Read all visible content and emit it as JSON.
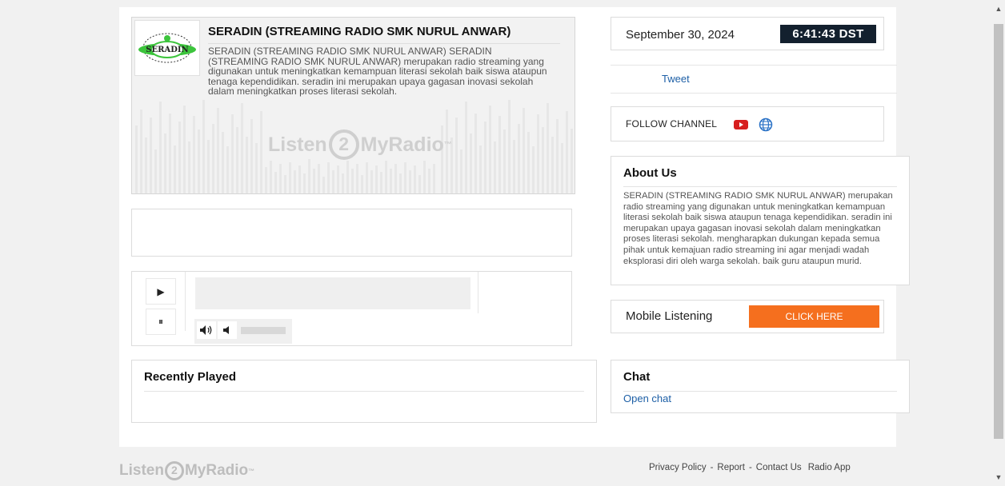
{
  "station": {
    "title": "SERADIN (STREAMING RADIO SMK NURUL ANWAR)",
    "description": "SERADIN (STREAMING RADIO SMK NURUL ANWAR) SERADIN (STREAMING RADIO SMK NURUL ANWAR) merupakan radio streaming yang digunakan untuk meningkatkan kemampuan literasi sekolah baik siswa ataupun tenaga kependidikan. seradin ini merupakan upaya gagasan inovasi sekolah dalam meningkatkan proses literasi sekolah.",
    "logo_text": "SERADIN",
    "watermark": {
      "left": "Listen",
      "two": "2",
      "right": "MyRadio",
      "tm": "™"
    }
  },
  "player": {
    "play_icon": "▶",
    "pause_icon": "⏸",
    "icons": [
      "play-icon",
      "pause-icon",
      "volume-up-icon",
      "volume-down-icon"
    ]
  },
  "recently_played": {
    "title": "Recently Played"
  },
  "datetime": {
    "date": "September 30, 2024",
    "time": "6:41:43 DST"
  },
  "social": {
    "tweet_label": "Tweet"
  },
  "follow": {
    "label": "FOLLOW CHANNEL",
    "icons": [
      "youtube-icon",
      "globe-icon"
    ]
  },
  "about": {
    "title": "About Us",
    "text": "SERADIN (STREAMING RADIO SMK NURUL ANWAR) merupakan radio streaming yang digunakan untuk meningkatkan kemampuan literasi sekolah baik siswa ataupun tenaga kependidikan. seradin ini merupakan upaya gagasan inovasi sekolah dalam meningkatkan proses literasi sekolah. mengharapkan dukungan kepada semua pihak untuk kemajuan radio streaming ini agar menjadi wadah eksplorasi diri oleh warga sekolah. baik guru ataupun murid."
  },
  "mobile": {
    "label": "Mobile Listening",
    "button": "CLICK HERE"
  },
  "chat": {
    "title": "Chat",
    "link": "Open chat"
  },
  "footer": {
    "logo": {
      "left": "Listen",
      "two": "2",
      "right": "MyRadio",
      "tm": "™"
    },
    "links": [
      "Privacy Policy",
      "Report",
      "Contact Us",
      "Radio App"
    ],
    "separator": "-"
  },
  "colors": {
    "accent": "#f56f1e",
    "link": "#1d5fa6",
    "clock_bg": "#13202e",
    "youtube": "#d71e1e"
  }
}
